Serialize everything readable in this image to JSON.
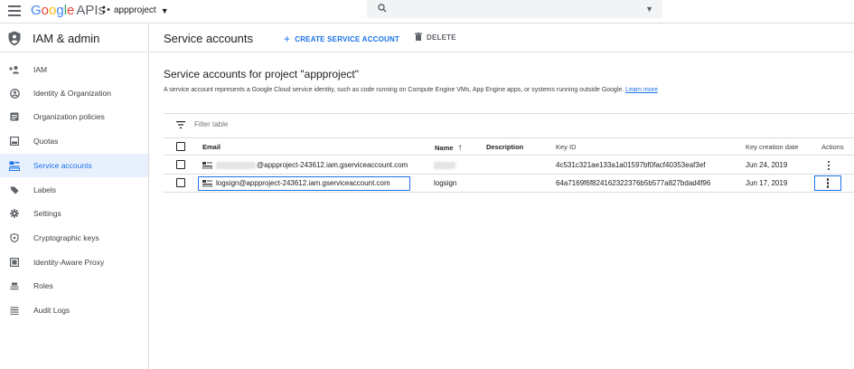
{
  "topbar": {
    "logo_google": [
      "G",
      "o",
      "o",
      "g",
      "l",
      "e"
    ],
    "logo_apis": "APIs",
    "project": "appproject",
    "search_placeholder": ""
  },
  "sidebar": {
    "title": "IAM & admin",
    "items": [
      {
        "label": "IAM",
        "icon": "person-add-icon",
        "active": false
      },
      {
        "label": "Identity & Organization",
        "icon": "account-circle-icon",
        "active": false
      },
      {
        "label": "Organization policies",
        "icon": "policy-doc-icon",
        "active": false
      },
      {
        "label": "Quotas",
        "icon": "quota-icon",
        "active": false
      },
      {
        "label": "Service accounts",
        "icon": "service-account-icon",
        "active": true
      },
      {
        "label": "Labels",
        "icon": "label-icon",
        "active": false
      },
      {
        "label": "Settings",
        "icon": "gear-icon",
        "active": false
      },
      {
        "label": "Cryptographic keys",
        "icon": "crypto-key-icon",
        "active": false
      },
      {
        "label": "Identity-Aware Proxy",
        "icon": "iap-icon",
        "active": false
      },
      {
        "label": "Roles",
        "icon": "roles-icon",
        "active": false
      },
      {
        "label": "Audit Logs",
        "icon": "audit-logs-icon",
        "active": false
      }
    ]
  },
  "main": {
    "page_title": "Service accounts",
    "create_label": "CREATE SERVICE ACCOUNT",
    "delete_label": "DELETE",
    "section_title": "Service accounts for project \"appproject\"",
    "section_desc": "A service account represents a Google Cloud service identity, such as code running on Compute Engine VMs, App Engine apps, or systems running outside Google.",
    "learn_more": "Learn more",
    "filter_placeholder": "Filter table"
  },
  "table": {
    "columns": {
      "email": "Email",
      "name": "Name",
      "name_sort": "↑",
      "description": "Description",
      "key_id": "Key ID",
      "key_creation_date": "Key creation date",
      "actions": "Actions"
    },
    "rows": [
      {
        "email": "@appproject-243612.iam.gserviceaccount.com",
        "name": "",
        "description": "",
        "key_id": "4c531c321ae133a1a01597bf0facf40353eaf3ef",
        "key_creation_date": "Jun 24, 2019"
      },
      {
        "email": "logsign@appproject-243612.iam.gserviceaccount.com",
        "name": "logsign",
        "description": "",
        "key_id": "64a7169f6f824162322376b5b577a827bdad4f96",
        "key_creation_date": "Jun 17, 2019"
      }
    ]
  },
  "colors": {
    "accent": "#1a73e8",
    "active_bg": "#e8f0fe",
    "divider": "#dadce0"
  }
}
